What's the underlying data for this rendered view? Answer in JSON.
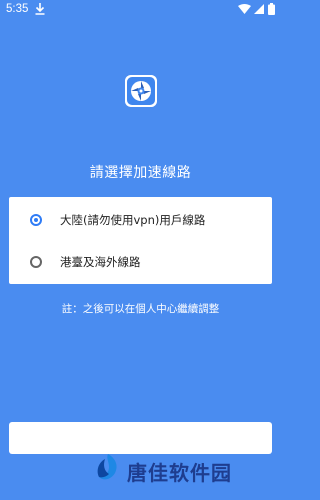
{
  "status_bar": {
    "time": "5:35",
    "icons": [
      "download-icon",
      "wifi-icon",
      "signal-icon",
      "battery-icon"
    ]
  },
  "app": {
    "logo_icon": "app-logo-icon",
    "title": "請選擇加速線路"
  },
  "options": [
    {
      "label": "大陸(請勿使用vpn)用戶線路",
      "checked": true
    },
    {
      "label": "港臺及海外線路",
      "checked": false
    }
  ],
  "note": "註：之後可以在個人中心繼續調整",
  "watermark": {
    "text": "唐佳软件园",
    "icon": "watermark-logo-icon",
    "color": "#1e3d8f"
  },
  "colors": {
    "background": "#4a8cf0",
    "accent": "#2f7cf6"
  }
}
